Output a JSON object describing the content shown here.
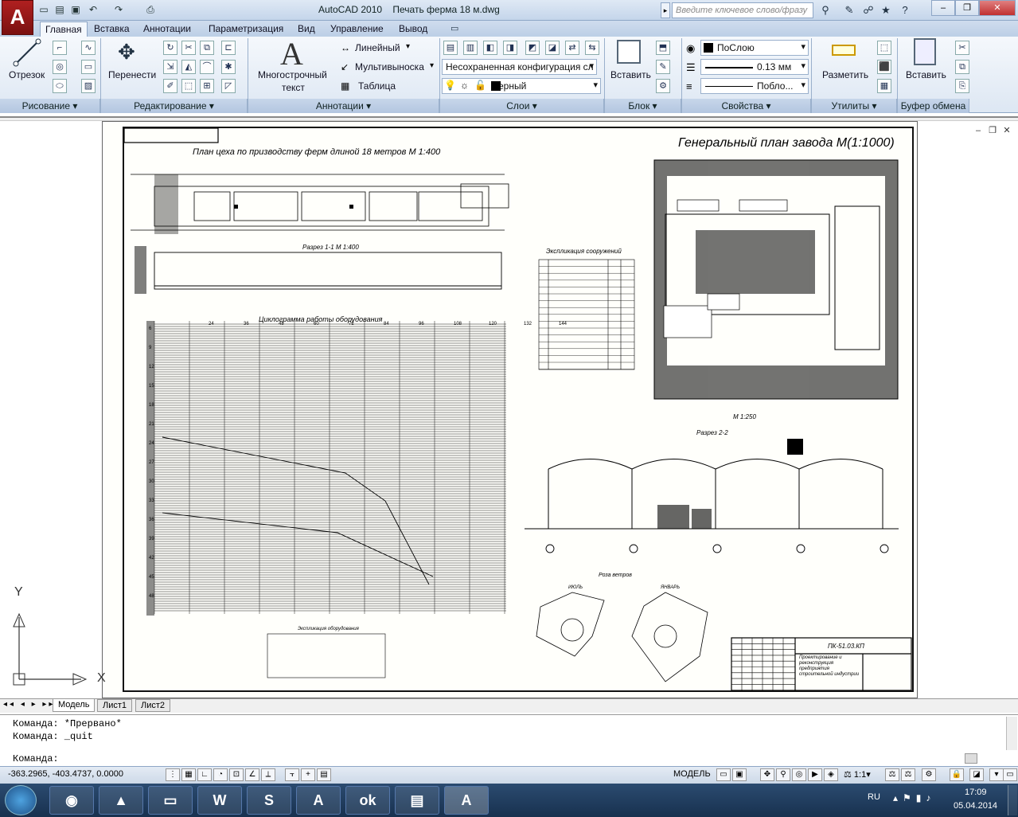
{
  "app": {
    "logo": "A",
    "version": "AutoCAD 2010",
    "document": "Печать ферма 18 м.dwg"
  },
  "qat_icons": [
    "new-icon",
    "open-icon",
    "save-icon",
    "undo-icon",
    "redo-icon",
    "plot-icon"
  ],
  "search": {
    "placeholder": "Введите ключевое слово/фразу"
  },
  "ribbon_tabs": [
    "Главная",
    "Вставка",
    "Аннотации",
    "Параметризация",
    "Вид",
    "Управление",
    "Вывод"
  ],
  "ribbon": {
    "draw": {
      "title": "Рисование",
      "line": "Отрезок"
    },
    "modify": {
      "title": "Редактирование",
      "move": "Перенести"
    },
    "annotation": {
      "title": "Аннотации",
      "mtext_1": "Многострочный",
      "mtext_2": "текст",
      "linear": "Линейный",
      "mleader": "Мультивыноска",
      "table": "Таблица"
    },
    "layers": {
      "title": "Слои",
      "config": "Несохраненная конфигурация сл",
      "current": "Черный"
    },
    "block": {
      "title": "Блок",
      "insert": "Вставить"
    },
    "properties": {
      "title": "Свойства",
      "color": "ПоСлою",
      "lineweight": "0.13 мм",
      "linetype": "Побло..."
    },
    "utilities": {
      "title": "Утилиты",
      "measure": "Разметить"
    },
    "clipboard": {
      "title": "Буфер обмена",
      "paste": "Вставить"
    }
  },
  "drawing": {
    "plan_title": "План цеха по призводству ферм длиной 18 метров   М 1:400",
    "section11": "Разрез 1-1  М 1:400",
    "cyclogram": "Циклограмма работы оборудования",
    "genplan": "Генеральный план завода М(1:1000)",
    "explication": "Экспликация сооружений",
    "scale250": "М 1:250",
    "section22": "Разрез 2-2",
    "windrose": "Роза ветров",
    "july": "ИЮЛЬ",
    "january": "ЯНВАРЬ",
    "equip_expl": "Экспликация оборудования",
    "stamp_code": "ПК-51.03.КП",
    "stamp_title": "Проектирование и реконструкция предприятия строительной индустрии",
    "axis_y": "Y",
    "axis_x": "X",
    "cyclogram_hours": [
      "24",
      "36",
      "48",
      "60",
      "72",
      "84",
      "96",
      "108",
      "120",
      "132",
      "144"
    ],
    "cyclogram_rows": [
      "6",
      "9",
      "12",
      "15",
      "18",
      "21",
      "24",
      "27",
      "30",
      "33",
      "36",
      "39",
      "42",
      "45",
      "48"
    ]
  },
  "layout_tabs": [
    "Модель",
    "Лист1",
    "Лист2"
  ],
  "command": {
    "line1": "Команда: *Прервано*",
    "line2": "Команда: _quit",
    "prompt": "Команда:"
  },
  "status": {
    "coords": "-363.2965, -403.4737, 0.0000",
    "model": "МОДЕЛЬ",
    "scale": "1:1"
  },
  "taskbar": {
    "lang": "RU",
    "time": "17:09",
    "date": "05.04.2014"
  }
}
